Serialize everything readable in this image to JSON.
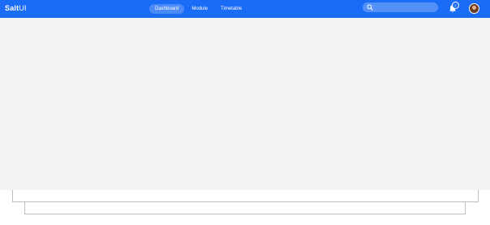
{
  "app": {
    "logo_bold": "Salt",
    "logo_light": "UI"
  },
  "nav": {
    "items": [
      {
        "label": "Dashboard",
        "active": true
      },
      {
        "label": "Module",
        "active": false
      },
      {
        "label": "Timetable",
        "active": false
      }
    ]
  },
  "search": {
    "placeholder": "",
    "value": "",
    "icon": "search-icon"
  },
  "notifications": {
    "count": "2",
    "icon": "bell-icon"
  },
  "user": {
    "avatar": "avatar"
  },
  "colors": {
    "brand": "#1a6bf5",
    "background": "#f2f3f5"
  }
}
